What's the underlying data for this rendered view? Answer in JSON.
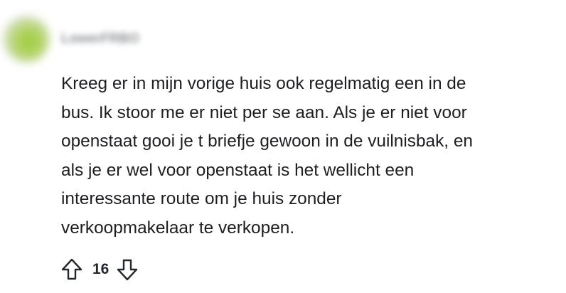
{
  "comment": {
    "author": "LowerFRBO",
    "body": "Kreeg er in mijn vorige huis ook regelmatig een in de\nbus. Ik stoor me er niet per se aan. Als je er niet voor\nopenstaat gooi je t briefje gewoon in de vuilnisbak, en\nals je er wel voor openstaat is het wellicht een\ninteressante route om je huis zonder\nverkoopmakelaar te verkopen.",
    "score": "16"
  },
  "icons": {
    "upvote": "arrow-up-outline-icon",
    "downvote": "arrow-down-outline-icon"
  },
  "colors": {
    "text": "#1c1e21",
    "icon": "#24272b",
    "background": "#ffffff"
  }
}
